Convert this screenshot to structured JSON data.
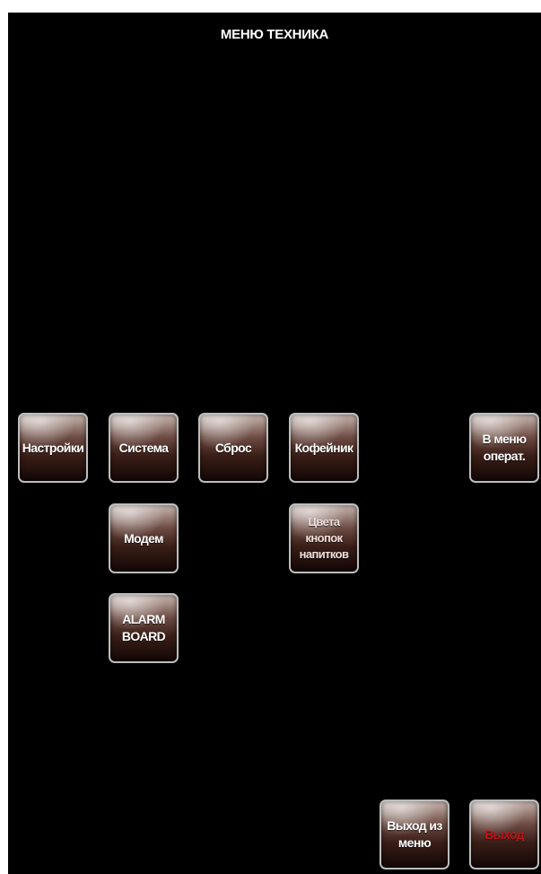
{
  "screen": {
    "title": "МЕНЮ ТЕХНИКА"
  },
  "buttons": {
    "settings": "Настройки",
    "system": "Система",
    "reset": "Сброс",
    "coffeemaker": "Кофейник",
    "operator_menu": "В меню\nоперат.",
    "modem": "Модем",
    "button_colors": "Цвета\nкнопок\nнапитков",
    "alarm_board": "ALARM\nBOARD",
    "exit_menu": "Выход из\nменю",
    "exit": "Выход"
  },
  "colors": {
    "background": "#000000",
    "button_text": "#ffffff",
    "exit_text": "#c1121a"
  }
}
